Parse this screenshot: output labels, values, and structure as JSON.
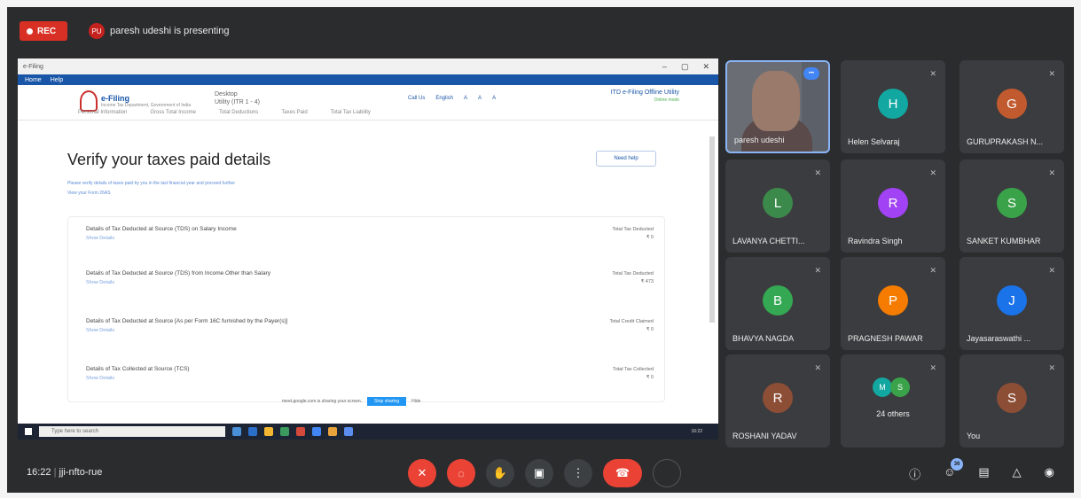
{
  "topbar": {
    "rec_label": "REC",
    "presenter_initials": "PU",
    "presenting_text": "paresh udeshi is presenting"
  },
  "screen": {
    "window_title": "e-Filing",
    "window_controls": [
      "–",
      "▢",
      "✕"
    ],
    "menu": [
      "Home",
      "Help"
    ],
    "logo_title": "e-Filing",
    "logo_sub": "Income Tax Department, Government of India",
    "desktop_line1": "Desktop",
    "desktop_line2": "Utility (ITR 1 - 4)",
    "header_links": [
      "Call Us",
      "English",
      "A",
      "A",
      "A"
    ],
    "itr_form": "ITD e-Filing Offline Utility",
    "itr_sub": "Online mode",
    "tabs": [
      "Personal Information",
      "Gross Total Income",
      "Total Deductions",
      "Taxes Paid",
      "Total Tax Liability"
    ],
    "heading": "Verify your taxes paid details",
    "need_help": "Need help",
    "intro_line": "Please verify details of taxes paid by you in the last financial year and proceed further",
    "intro_link": "View your Form 26AS",
    "rows": [
      {
        "label": "Details of Tax Deducted at Source (TDS) on Salary Income",
        "link": "Show Details",
        "right_title": "Total Tax Deducted",
        "right_value": "₹ 0"
      },
      {
        "label": "Details of Tax Deducted at Source (TDS) from Income Other than Salary",
        "link": "Show Details",
        "right_title": "Total Tax Deducted",
        "right_value": "₹ 473"
      },
      {
        "label": "Details of Tax Deducted at Source [As per Form 16C furnished by the Payer(s)]",
        "link": "Show Details",
        "right_title": "Total Credit Claimed",
        "right_value": "₹ 0"
      },
      {
        "label": "Details of Tax Collected at Source (TCS)",
        "link": "Show Details",
        "right_title": "Total Tax Collected",
        "right_value": "₹ 0"
      }
    ],
    "share_notice": "meet.google.com is sharing your screen.",
    "stop_sharing": "Stop sharing",
    "hide": "Hide",
    "taskbar_search": "Type here to search",
    "taskbar_time": "16:22"
  },
  "tiles": [
    {
      "name": "paresh udeshi",
      "initial": "",
      "color": "",
      "video": true
    },
    {
      "name": "Helen Selvaraj",
      "initial": "H",
      "color": "#12a7a0"
    },
    {
      "name": "GURUPRAKASH N...",
      "initial": "G",
      "color": "#c15a2e"
    },
    {
      "name": "LAVANYA CHETTI...",
      "initial": "L",
      "color": "#3c8a4b"
    },
    {
      "name": "Ravindra Singh",
      "initial": "R",
      "color": "#a142f4"
    },
    {
      "name": "SANKET KUMBHAR",
      "initial": "S",
      "color": "#3aa34a"
    },
    {
      "name": "BHAVYA NAGDA",
      "initial": "B",
      "color": "#34a853"
    },
    {
      "name": "PRAGNESH PAWAR",
      "initial": "P",
      "color": "#f57c00"
    },
    {
      "name": "Jayasaraswathi ...",
      "initial": "J",
      "color": "#1a73e8"
    },
    {
      "name": "ROSHANI YADAV",
      "initial": "R",
      "color": "#8d4e36"
    },
    {
      "name": "24 others",
      "initials": [
        "M",
        "S"
      ],
      "colors": [
        "#12a7a0",
        "#3aa34a"
      ]
    },
    {
      "name": "You",
      "initial": "S",
      "color": "#8d4e36"
    }
  ],
  "bottom": {
    "time": "16:22",
    "meeting_code": "jji-nfto-rue",
    "participants_count": "36"
  }
}
